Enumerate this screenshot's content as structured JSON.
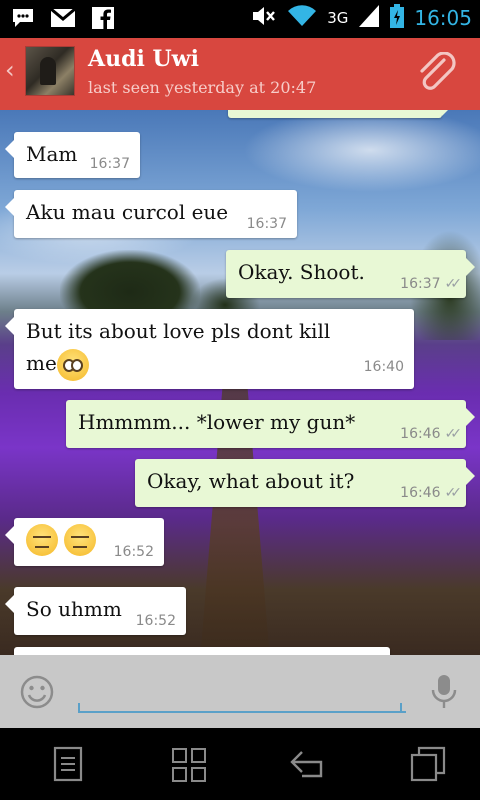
{
  "status_bar": {
    "network": "3G",
    "time": "16:05",
    "icons": [
      "bbm-icon",
      "gmail-icon",
      "facebook-icon",
      "mute-icon",
      "wifi-icon",
      "signal-icon",
      "battery-icon"
    ]
  },
  "header": {
    "contact_name": "Audi Uwi",
    "last_seen": "last seen yesterday at 20:47",
    "color": "#d8473f"
  },
  "messages": [
    {
      "direction": "in",
      "text": "Mam",
      "time": "16:37"
    },
    {
      "direction": "in",
      "text": "Aku mau curcol eue",
      "time": "16:37"
    },
    {
      "direction": "out",
      "text": "Okay. Shoot.",
      "time": "16:37"
    },
    {
      "direction": "in",
      "text": "But its about love pls dont kill",
      "text2": "me",
      "emoji": "flushed-face",
      "time": "16:40"
    },
    {
      "direction": "out",
      "text": "Hmmmm... *lower my gun*",
      "time": "16:46"
    },
    {
      "direction": "out",
      "text": "Okay, what about it?",
      "time": "16:46"
    },
    {
      "direction": "in",
      "text": "",
      "emoji": "expressionless-face",
      "time": "16:52"
    },
    {
      "direction": "in",
      "text": "So uhmm",
      "time": "16:52"
    }
  ],
  "input": {
    "value": "",
    "placeholder": ""
  },
  "nav": [
    "menu-icon",
    "recent-apps-icon",
    "back-icon",
    "multiwindow-icon"
  ]
}
